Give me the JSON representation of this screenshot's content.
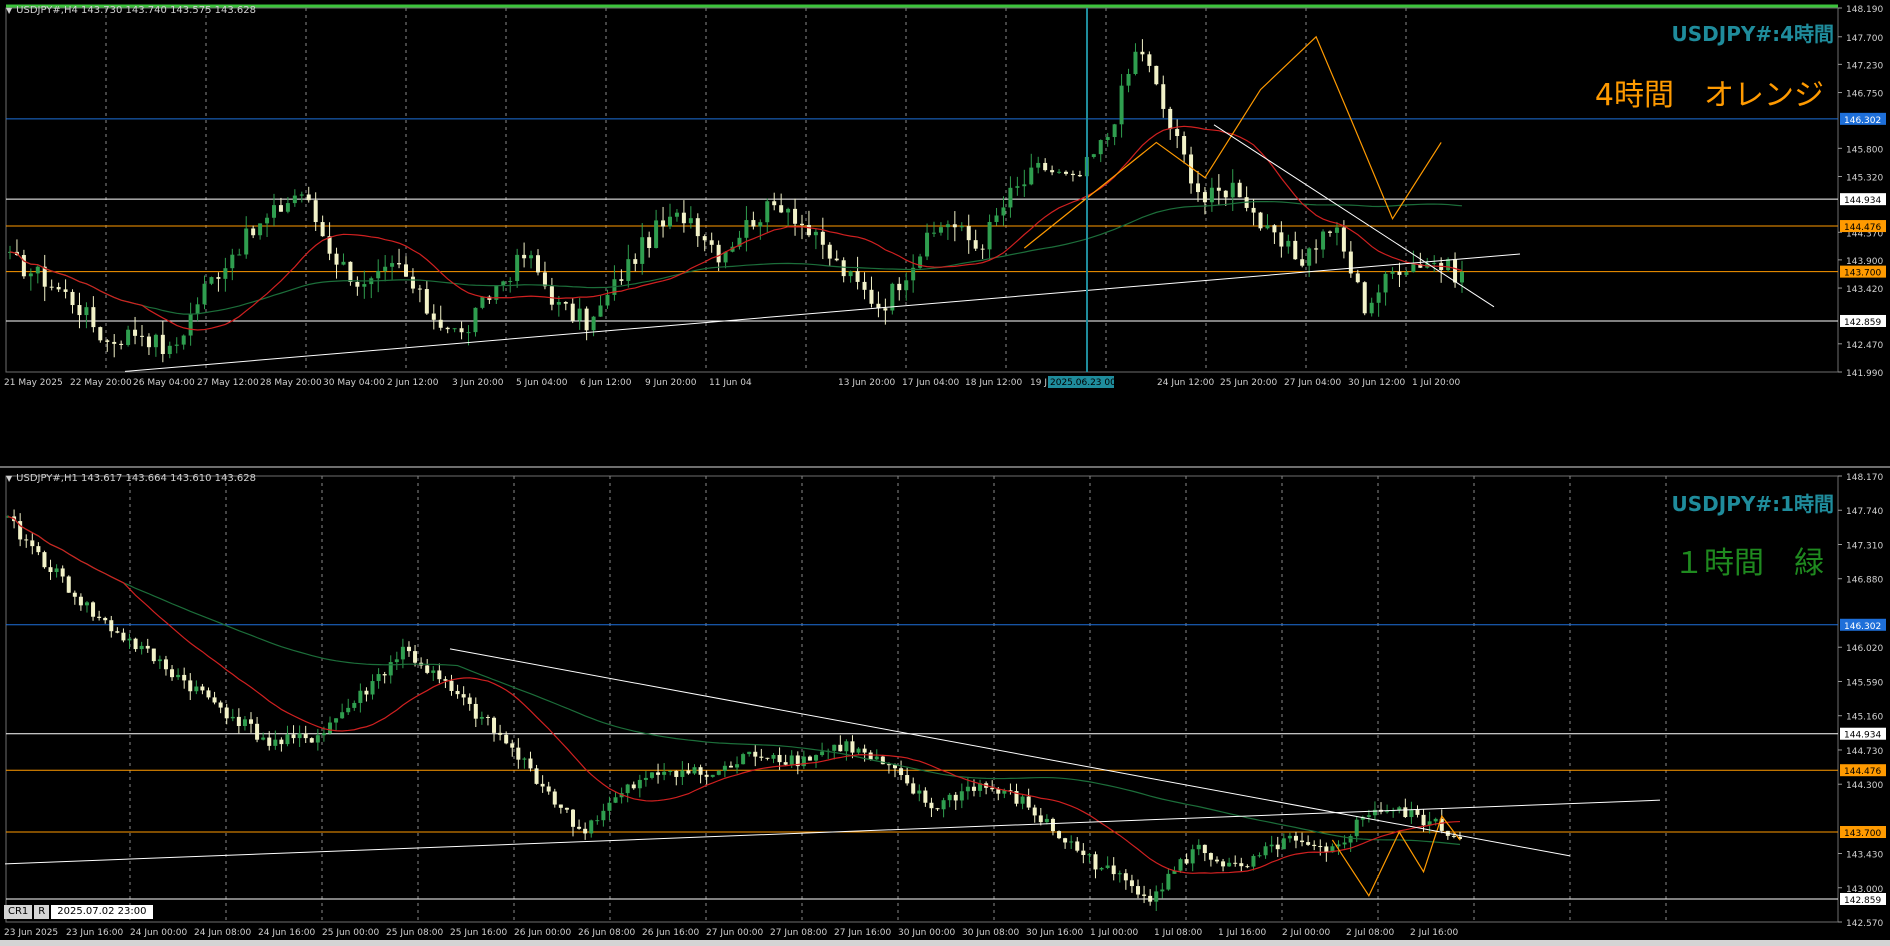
{
  "panels": {
    "h4": {
      "header": "USDJPY#,H4  143.730 143.740 143.575 143.628",
      "symbol_title": "USDJPY#:4時間",
      "big_label": "4時間　オレンジ",
      "big_label_color": "#ff9a00",
      "y_ticks": [
        "148.190",
        "147.700",
        "147.230",
        "146.750",
        "145.800",
        "145.320",
        "144.370",
        "143.900",
        "143.420",
        "142.470",
        "141.990"
      ],
      "hlines": [
        {
          "label": "146.302",
          "color": "#1e6fd9"
        },
        {
          "label": "144.934",
          "color": "#ffffff"
        },
        {
          "label": "144.476",
          "color": "#ff9a00"
        },
        {
          "label": "143.700",
          "color": "#ff9a00"
        },
        {
          "label": "142.859",
          "color": "#ffffff"
        }
      ],
      "x_labels": [
        "21 May 2025",
        "22 May 20:00",
        "26 May 04:00",
        "27 May 12:00",
        "28 May 20:00",
        "30 May 04:00",
        "2 Jun 12:00",
        "3 Jun 20:00",
        "5 Jun 04:00",
        "6 Jun 12:00",
        "9 Jun 20:00",
        "11 Jun 04",
        "13 Jun 20:00",
        "17 Jun 04:00",
        "18 Jun 12:00",
        "19 J",
        "2025.06.23 00:00",
        "24 Jun 12:00",
        "25 Jun 20:00",
        "27 Jun 04:00",
        "30 Jun 12:00",
        "1 Jul 20:00"
      ],
      "hidden_price_label": "143.628"
    },
    "h1": {
      "header": "USDJPY#,H1  143.617 143.664 143.610 143.628",
      "symbol_title": "USDJPY#:1時間",
      "big_label": "１時間　緑",
      "big_label_color": "#1f8a1f",
      "y_ticks": [
        "148.170",
        "147.740",
        "147.310",
        "146.880",
        "146.020",
        "145.590",
        "145.160",
        "144.730",
        "144.300",
        "143.430",
        "143.000",
        "142.570"
      ],
      "hlines": [
        {
          "label": "146.302",
          "color": "#1e6fd9"
        },
        {
          "label": "144.934",
          "color": "#ffffff"
        },
        {
          "label": "144.476",
          "color": "#ff9a00"
        },
        {
          "label": "143.700",
          "color": "#ff9a00"
        },
        {
          "label": "142.859",
          "color": "#ffffff"
        }
      ],
      "x_labels": [
        "23 Jun 2025",
        "23 Jun 16:00",
        "24 Jun 00:00",
        "24 Jun 08:00",
        "24 Jun 16:00",
        "25 Jun 00:00",
        "25 Jun 08:00",
        "25 Jun 16:00",
        "26 Jun 00:00",
        "26 Jun 08:00",
        "26 Jun 16:00",
        "27 Jun 00:00",
        "27 Jun 08:00",
        "27 Jun 16:00",
        "30 Jun 00:00",
        "30 Jun 08:00",
        "30 Jun 16:00",
        "1 Jul 00:00",
        "1 Jul 08:00",
        "1 Jul 16:00",
        "2 Jul 00:00",
        "2 Jul 08:00",
        "2 Jul 16:00"
      ],
      "hidden_price_label": "143.628"
    }
  },
  "crosshair_box": {
    "cr": "CR1",
    "r": "R",
    "datetime": "2025.07.02 23:00"
  },
  "colors": {
    "bull": "#2f9e4f",
    "bear": "#f2f2c8",
    "ma_red": "#d02020",
    "ma_green": "#1c6e3a",
    "zigzag": "#ff9a00",
    "trend": "#ffffff",
    "grid": "#8a8a8a",
    "cursor_line": "#1f8c9c"
  },
  "chart_data": [
    {
      "type": "candlestick",
      "title": "USDJPY#:4時間",
      "timeframe": "H4",
      "ylim": [
        141.99,
        148.19
      ],
      "x_range": [
        "21 May 2025",
        "2 Jul 2025"
      ],
      "grid": true,
      "levels": [
        146.302,
        144.934,
        144.476,
        143.7,
        142.859
      ],
      "close_path": [
        143.9,
        143.6,
        143.2,
        142.5,
        142.7,
        142.3,
        143.4,
        144.1,
        144.6,
        145.1,
        144.0,
        143.4,
        143.8,
        143.0,
        142.6,
        143.4,
        144.0,
        143.1,
        142.8,
        143.7,
        144.4,
        144.7,
        144.0,
        144.6,
        144.9,
        144.2,
        143.6,
        143.1,
        143.9,
        144.6,
        144.1,
        145.0,
        145.5,
        145.2,
        146.0,
        147.6,
        146.1,
        144.9,
        145.2,
        144.3,
        143.9,
        144.5,
        143.1,
        143.8,
        143.9,
        143.628
      ]
    },
    {
      "type": "candlestick",
      "title": "USDJPY#:1時間",
      "timeframe": "H1",
      "ylim": [
        142.57,
        148.17
      ],
      "x_range": [
        "23 Jun 2025",
        "2 Jul 2025"
      ],
      "grid": true,
      "levels": [
        146.302,
        144.934,
        144.476,
        143.7,
        142.859
      ],
      "close_path": [
        147.6,
        147.0,
        146.4,
        146.0,
        145.6,
        145.2,
        144.8,
        144.9,
        145.4,
        146.0,
        145.5,
        145.0,
        144.4,
        143.7,
        144.2,
        144.5,
        144.4,
        144.7,
        144.6,
        144.8,
        144.5,
        144.0,
        144.3,
        144.1,
        143.6,
        143.2,
        142.9,
        143.5,
        143.2,
        143.6,
        143.4,
        144.0,
        143.9,
        143.628
      ]
    }
  ]
}
